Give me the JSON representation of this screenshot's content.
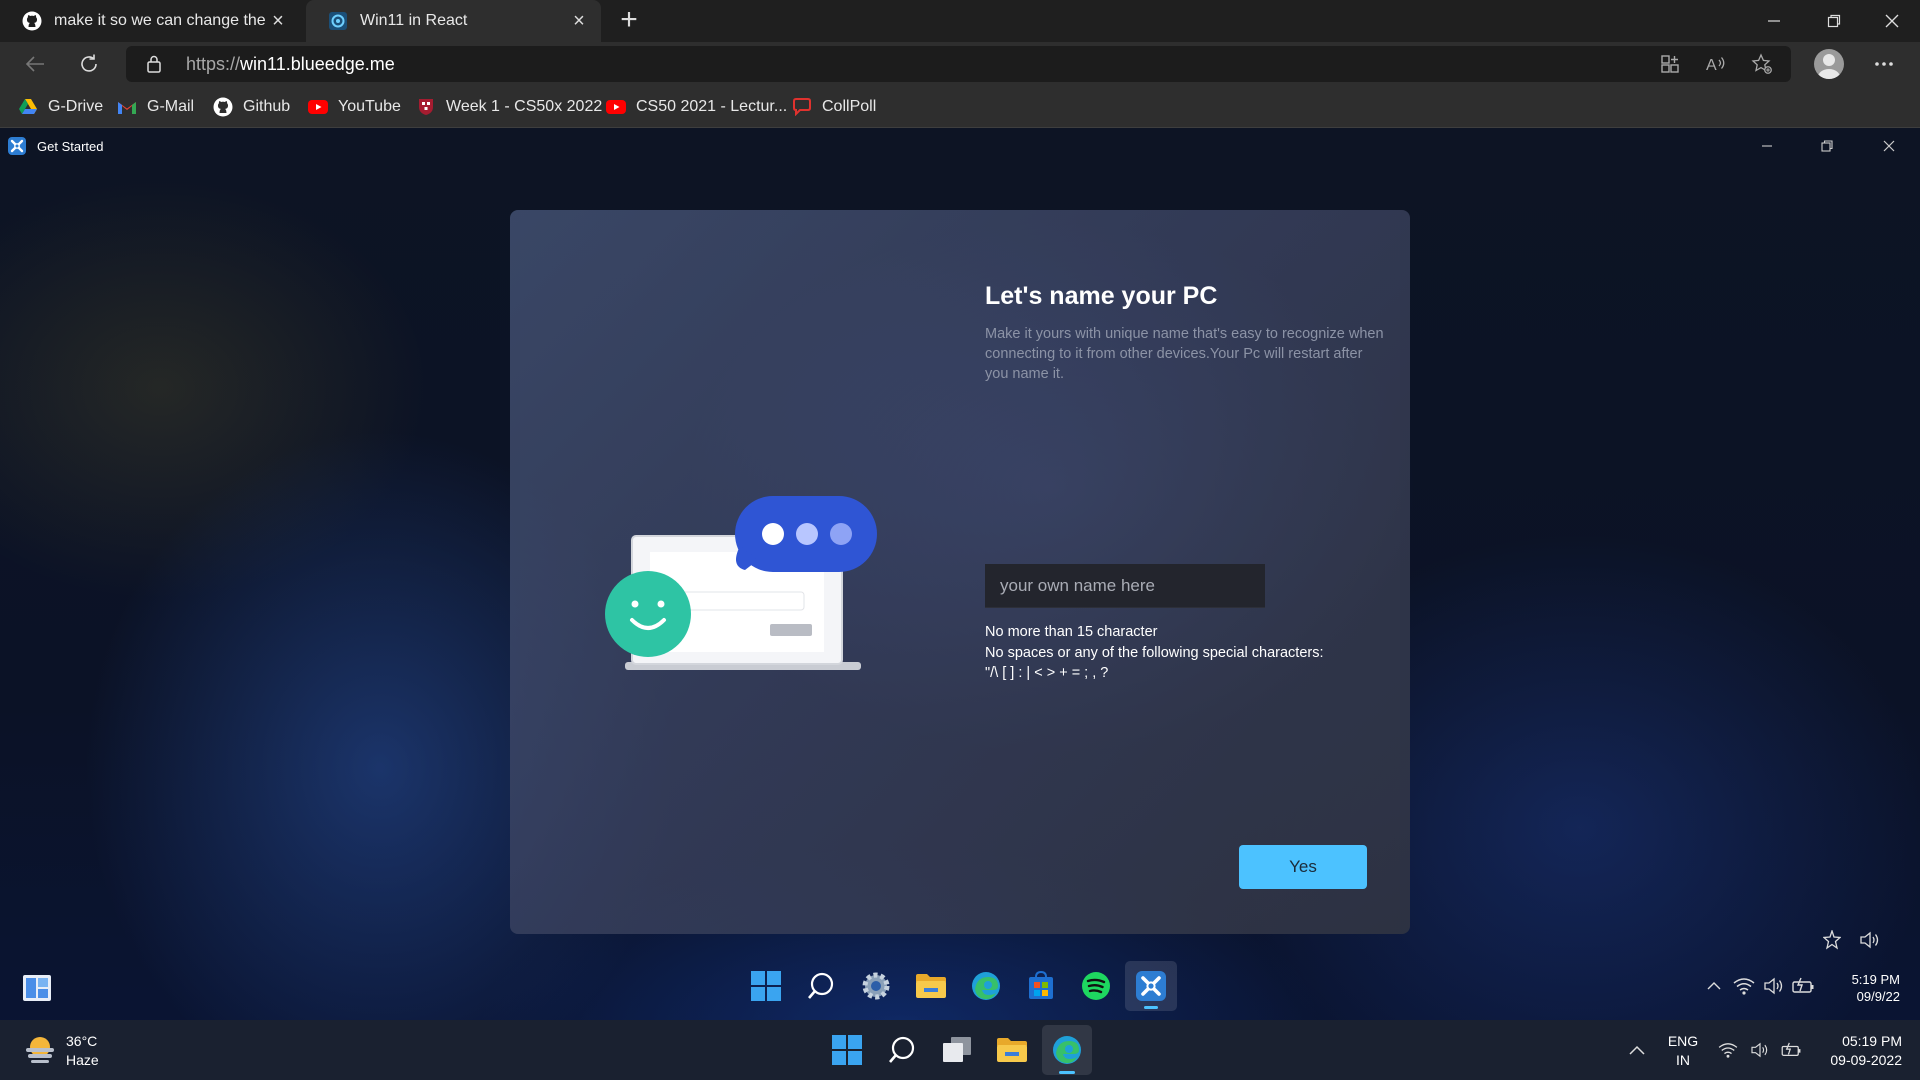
{
  "browser": {
    "tabs": [
      {
        "title": "make it so we can change the na",
        "active": false
      },
      {
        "title": "Win11 in React",
        "active": true
      }
    ],
    "url_protocol": "https://",
    "url_host": "win11.blueedge.me",
    "bookmarks": [
      "G-Drive",
      "G-Mail",
      "Github",
      "YouTube",
      "Week 1 - CS50x 2022",
      "CS50 2021 - Lectur...",
      "CollPoll"
    ]
  },
  "app": {
    "title": "Get Started"
  },
  "oobe": {
    "heading": "Let's name your PC",
    "description": "Make it yours with unique name that's easy to recognize when connecting to it from other devices.Your Pc will restart after you name it.",
    "input_placeholder": "your own name here",
    "rule1": "No more than 15 character",
    "rule2": "No spaces or any of the following special characters:",
    "rule3": "\"/\\ [ ] : | < > + = ; , ?",
    "yes_label": "Yes"
  },
  "inner_taskbar": {
    "time": "5:19 PM",
    "date": "09/9/22"
  },
  "os_taskbar": {
    "temperature": "36°C",
    "condition": "Haze",
    "lang_line1": "ENG",
    "lang_line2": "IN",
    "time": "05:19 PM",
    "date": "09-09-2022"
  },
  "colors": {
    "accent": "#4cc2ff",
    "card": "#3b4256",
    "taskbar": "#1a2130"
  }
}
